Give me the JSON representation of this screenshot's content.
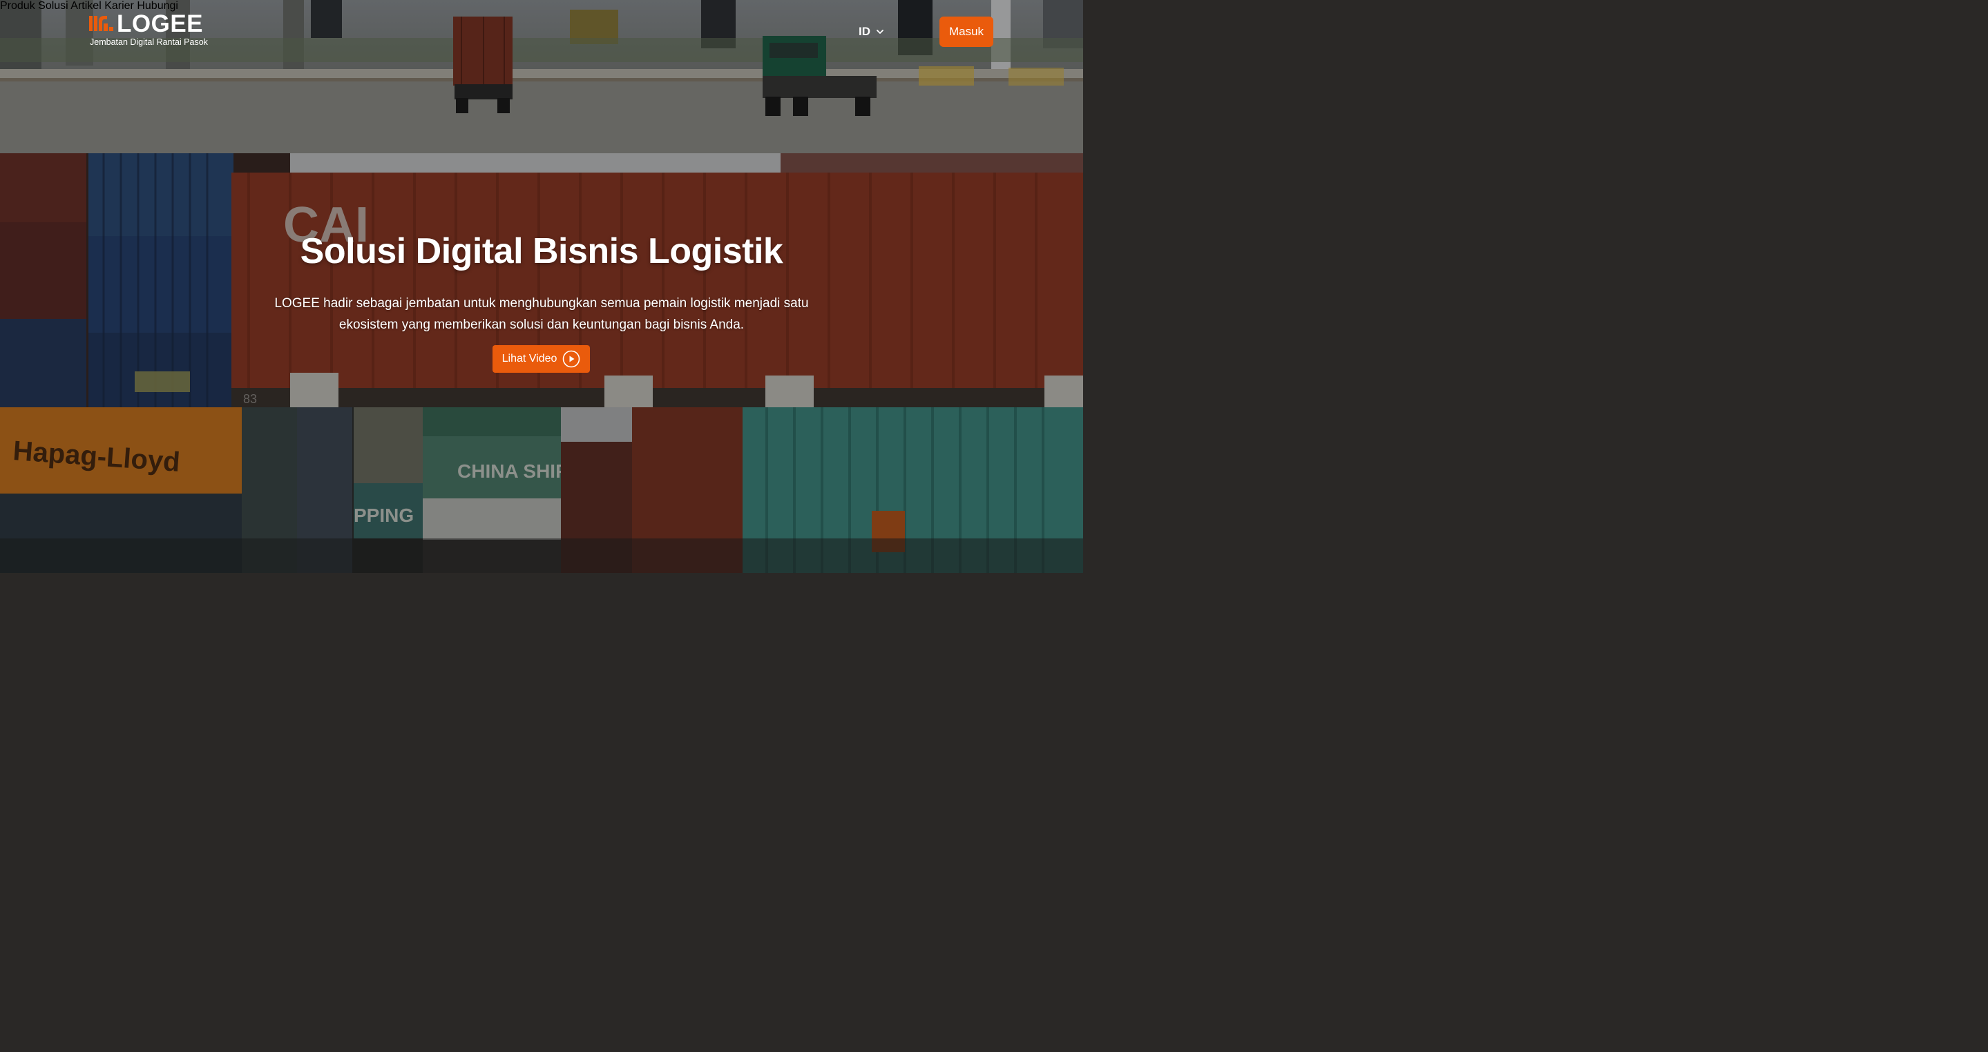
{
  "brand": {
    "name": "LOGEE",
    "tagline": "Jembatan Digital Rantai Pasok",
    "accent": "#ea5b0c"
  },
  "nav": {
    "items": [
      {
        "label": "Produk"
      },
      {
        "label": "Solusi"
      },
      {
        "label": "Artikel"
      },
      {
        "label": "Karier"
      },
      {
        "label": "Hubungi"
      }
    ],
    "language": "ID",
    "login_label": "Masuk"
  },
  "hero": {
    "title": "Solusi Digital Bisnis Logistik",
    "description": "LOGEE hadir sebagai jembatan untuk menghubungkan semua pemain logistik menjadi satu ekosistem yang memberikan solusi dan keuntungan bagi bisnis Anda.",
    "cta_label": "Lihat Video"
  },
  "background": {
    "container_texts": [
      "CAI",
      "Hapag-Lloyd",
      "CHINA SHIPPING",
      "PPING",
      "83"
    ]
  }
}
